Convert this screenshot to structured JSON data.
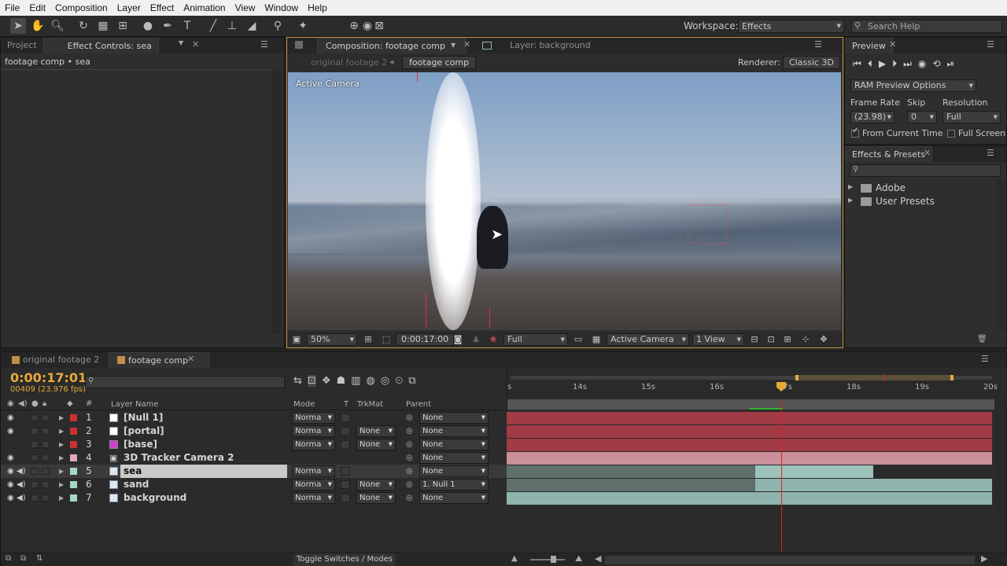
{
  "menu": [
    "File",
    "Edit",
    "Composition",
    "Layer",
    "Effect",
    "Animation",
    "View",
    "Window",
    "Help"
  ],
  "workspace": {
    "label": "Workspace:",
    "value": "Effects",
    "search_placeholder": "Search Help"
  },
  "left_panel": {
    "tab_project": "Project",
    "tab_effect": "Effect Controls: sea",
    "breadcrumb": "footage comp • sea"
  },
  "comp_panel": {
    "tab_comp": "Composition: footage comp",
    "tab_layer": "Layer: background",
    "subtab_inactive": "original footage 2",
    "subtab_active": "footage comp",
    "renderer_label": "Renderer:",
    "renderer_value": "Classic 3D",
    "active_camera_label": "Active Camera",
    "zoom": "50%",
    "timecode": "0:00:17:00",
    "resolution": "Full",
    "camera": "Active Camera",
    "views": "1 View"
  },
  "preview": {
    "title": "Preview",
    "ram_options": "RAM Preview Options",
    "frame_rate_label": "Frame Rate",
    "skip_label": "Skip",
    "resolution_label": "Resolution",
    "frame_rate": "(23.98)",
    "skip": "0",
    "resolution": "Full",
    "from_current_time": "From Current Time",
    "full_screen": "Full Screen"
  },
  "effects_presets": {
    "title": "Effects & Presets",
    "items": [
      "Adobe",
      "User Presets"
    ]
  },
  "timeline": {
    "tab_inactive": "original footage 2",
    "tab_active": "footage comp",
    "timecode": "0:00:17:01",
    "frames": "00409 (23.976 fps)",
    "col_layer_name": "Layer Name",
    "col_mode": "Mode",
    "col_t": "T",
    "col_trkmat": "TrkMat",
    "col_parent": "Parent",
    "ruler_ticks": [
      "s",
      "14s",
      "15s",
      "16s",
      "17s",
      "18s",
      "19s",
      "20s"
    ],
    "toggle_label": "Toggle Switches / Modes",
    "layers": [
      {
        "num": "1",
        "name": "[Null 1]",
        "mode": "Norma",
        "trkmat": "",
        "parent": "None",
        "label_color": "#c83232",
        "swatch": "#ffffff"
      },
      {
        "num": "2",
        "name": "[portal]",
        "mode": "Norma",
        "trkmat": "None",
        "parent": "None",
        "label_color": "#c83232",
        "swatch": "#ffffff"
      },
      {
        "num": "3",
        "name": "[base]",
        "mode": "Norma",
        "trkmat": "None",
        "parent": "None",
        "label_color": "#c83232",
        "swatch": "#d040d0"
      },
      {
        "num": "4",
        "name": "3D Tracker Camera 2",
        "mode": "",
        "trkmat": "",
        "parent": "None",
        "label_color": "#e3a6b6",
        "swatch": ""
      },
      {
        "num": "5",
        "name": "sea",
        "mode": "Norma",
        "trkmat": "",
        "parent": "None",
        "label_color": "#a6d6cc",
        "swatch": ""
      },
      {
        "num": "6",
        "name": "sand",
        "mode": "Norma",
        "trkmat": "None",
        "parent": "1. Null 1",
        "label_color": "#a6d6cc",
        "swatch": ""
      },
      {
        "num": "7",
        "name": "background",
        "mode": "Norma",
        "trkmat": "None",
        "parent": "None",
        "label_color": "#a6d6cc",
        "swatch": ""
      }
    ]
  },
  "colors": {
    "accent": "#e8a93a",
    "playhead": "#e02020",
    "layer_red": "#a13b45",
    "layer_pink": "#c9909b",
    "layer_teal": "#8fb4ae"
  }
}
